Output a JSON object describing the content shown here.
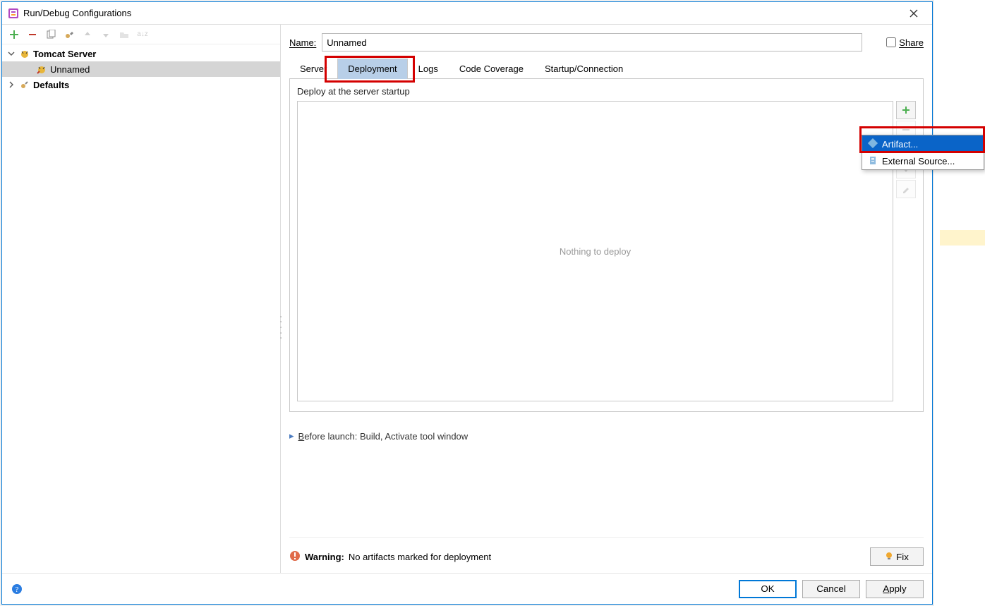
{
  "window": {
    "title": "Run/Debug Configurations"
  },
  "toolbar": {
    "add": "+",
    "remove": "−",
    "copy": "⧉",
    "save": "🔧",
    "up": "↑",
    "down": "↓",
    "folder": "📁",
    "sort": "a↓z"
  },
  "tree": {
    "tomcat": "Tomcat Server",
    "unnamed": "Unnamed",
    "defaults": "Defaults"
  },
  "name_label": "Name:",
  "name_value": "Unnamed",
  "share_label": "Share",
  "tabs": {
    "server": "Server",
    "deployment": "Deployment",
    "logs": "Logs",
    "code_coverage": "Code Coverage",
    "startup": "Startup/Connection"
  },
  "deploy_section": "Deploy at the server startup",
  "deploy_placeholder": "Nothing to deploy",
  "before_launch": "Before launch: Build, Activate tool window",
  "warning_label": "Warning:",
  "warning_text": " No artifacts marked for deployment",
  "fix_label": "Fix",
  "footer": {
    "ok": "OK",
    "cancel": "Cancel",
    "apply": "Apply"
  },
  "popup": {
    "artifact": "Artifact...",
    "external": "External Source..."
  }
}
